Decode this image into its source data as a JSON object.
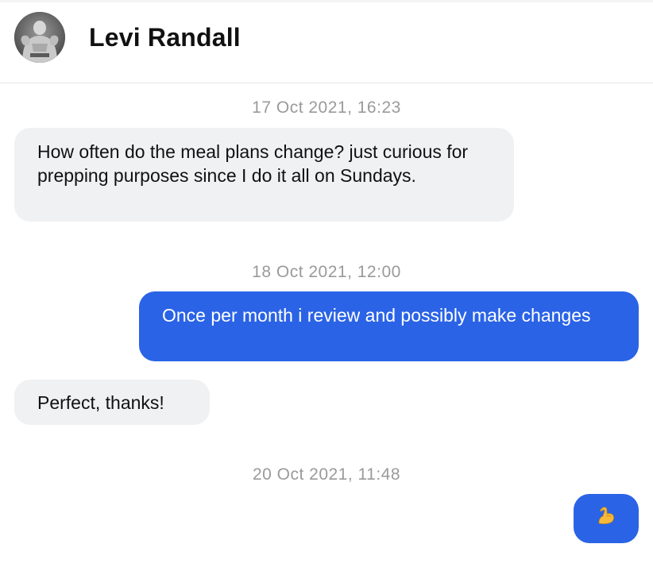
{
  "contact": {
    "name": "Levi Randall"
  },
  "messages": [
    {
      "timestamp": "17 Oct 2021, 16:23",
      "direction": "incoming",
      "text": "How often do the meal plans change? just curious for prepping purposes since I do it all on Sundays."
    },
    {
      "timestamp": "18 Oct 2021, 12:00",
      "direction": "outgoing",
      "text": "Once per month i review and possibly make changes"
    },
    {
      "direction": "incoming",
      "text": "Perfect, thanks!"
    },
    {
      "timestamp": "20 Oct 2021, 11:48",
      "direction": "outgoing",
      "emoji": "flexed-biceps-icon"
    }
  ],
  "colors": {
    "outgoing_bubble": "#2a63e6",
    "incoming_bubble": "#f0f1f3",
    "timestamp_text": "#9a9a9a"
  }
}
